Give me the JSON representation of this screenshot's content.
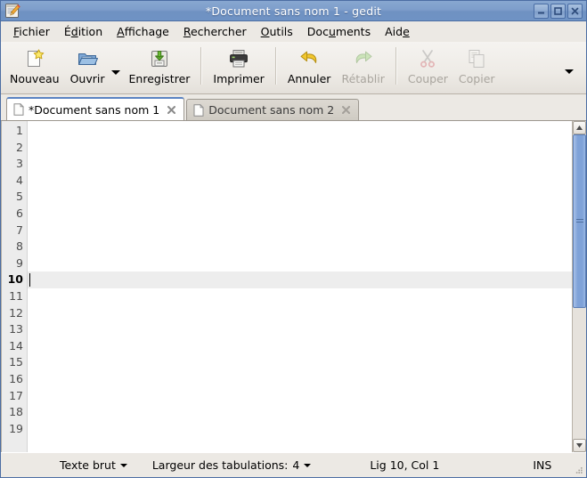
{
  "window": {
    "title": "*Document sans nom 1 - gedit",
    "app_icon": "gedit-notepad-icon",
    "controls": {
      "minimize": "minimize-button",
      "maximize": "maximize-button",
      "close": "close-button"
    },
    "accent_title_bg": "#6f93c4",
    "chrome_bg": "#ece9e4"
  },
  "menubar": {
    "items": [
      {
        "label": "Fichier",
        "pre": "",
        "mnemonic": "F",
        "post": "ichier"
      },
      {
        "label": "Édition",
        "pre": "É",
        "mnemonic": "d",
        "post": "ition"
      },
      {
        "label": "Affichage",
        "pre": "",
        "mnemonic": "A",
        "post": "ffichage"
      },
      {
        "label": "Rechercher",
        "pre": "",
        "mnemonic": "R",
        "post": "echercher"
      },
      {
        "label": "Outils",
        "pre": "",
        "mnemonic": "O",
        "post": "utils"
      },
      {
        "label": "Documents",
        "pre": "Doc",
        "mnemonic": "u",
        "post": "ments"
      },
      {
        "label": "Aide",
        "pre": "Aid",
        "mnemonic": "e",
        "post": ""
      }
    ]
  },
  "toolbar": {
    "buttons": [
      {
        "label": "Nouveau",
        "icon": "new-document-icon",
        "enabled": true
      },
      {
        "label": "Ouvrir",
        "icon": "open-folder-icon",
        "enabled": true
      },
      {
        "label": "Enregistrer",
        "icon": "save-icon",
        "enabled": true
      },
      {
        "label": "Imprimer",
        "icon": "print-icon",
        "enabled": true
      },
      {
        "label": "Annuler",
        "icon": "undo-arrow-icon",
        "enabled": true
      },
      {
        "label": "Rétablir",
        "icon": "redo-arrow-icon",
        "enabled": false
      },
      {
        "label": "Couper",
        "icon": "scissors-icon",
        "enabled": false
      },
      {
        "label": "Copier",
        "icon": "copy-icon",
        "enabled": false
      }
    ],
    "open_dropdown": "chevron-down-icon",
    "overflow": "chevron-down-icon"
  },
  "tabs": [
    {
      "title": "*Document sans nom 1",
      "active": true,
      "close": "close-icon",
      "icon": "page-icon"
    },
    {
      "title": "Document sans nom 2",
      "active": false,
      "close": "close-icon",
      "icon": "page-icon"
    }
  ],
  "editor": {
    "line_numbers": [
      "1",
      "2",
      "3",
      "4",
      "5",
      "6",
      "7",
      "8",
      "9",
      "10",
      "11",
      "12",
      "13",
      "14",
      "15",
      "16",
      "17",
      "18",
      "19"
    ],
    "current_line_index": 9,
    "lines": [
      "",
      "",
      "",
      "",
      "",
      "",
      "",
      "",
      "",
      "",
      "",
      "",
      "",
      "",
      "",
      "",
      "",
      "",
      ""
    ],
    "cursor_line": "10",
    "cursor_column": "1"
  },
  "scrollbar": {
    "up_arrow": "scroll-up-icon",
    "down_arrow": "scroll-down-icon",
    "thumb_position_pct": 0,
    "thumb_size_pct": 57
  },
  "statusbar": {
    "language": "Texte brut",
    "language_dropdown": "chevron-down-icon",
    "tab_width_label": "Largeur des tabulations:",
    "tab_width_value": "4",
    "tab_width_dropdown": "chevron-down-icon",
    "position": "Lig 10, Col 1",
    "insert_mode": "INS"
  }
}
